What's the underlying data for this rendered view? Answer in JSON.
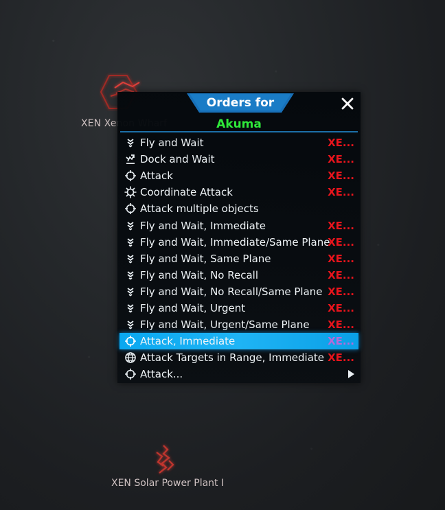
{
  "map": {
    "wharf_label": "XEN Xenon Wharf",
    "solar_label": "XEN Solar Power Plant I"
  },
  "panel": {
    "title": "Orders for",
    "ship_name": "Akuma",
    "close_icon": "close-icon",
    "colors": {
      "accent": "#1c6fa8",
      "ship_name": "#2fe83a",
      "target": "#e8141c",
      "selected_bg": "#0aa8f0"
    },
    "items": [
      {
        "label": "Fly and Wait",
        "target": "XE...",
        "icon": "fly-wait-icon"
      },
      {
        "label": "Dock and Wait",
        "target": "XE...",
        "icon": "dock-wait-icon"
      },
      {
        "label": "Attack",
        "target": "XE...",
        "icon": "crosshair-icon"
      },
      {
        "label": "Coordinate Attack",
        "target": "XE...",
        "icon": "coordinate-attack-icon"
      },
      {
        "label": "Attack multiple objects",
        "target": "",
        "icon": "crosshair-icon"
      },
      {
        "label": "Fly and Wait, Immediate",
        "target": "XE...",
        "icon": "fly-wait-icon"
      },
      {
        "label": "Fly and Wait, Immediate/Same Plane",
        "target": "XE...",
        "icon": "fly-wait-icon"
      },
      {
        "label": "Fly and Wait, Same Plane",
        "target": "XE...",
        "icon": "fly-wait-icon"
      },
      {
        "label": "Fly and Wait, No Recall",
        "target": "XE...",
        "icon": "fly-wait-icon"
      },
      {
        "label": "Fly and Wait, No Recall/Same Plane",
        "target": "XE...",
        "icon": "fly-wait-icon"
      },
      {
        "label": "Fly and Wait, Urgent",
        "target": "XE...",
        "icon": "fly-wait-icon"
      },
      {
        "label": "Fly and Wait, Urgent/Same Plane",
        "target": "XE...",
        "icon": "fly-wait-icon"
      },
      {
        "label": "Attack, Immediate",
        "target": "XE...",
        "icon": "crosshair-icon",
        "selected": true
      },
      {
        "label": "Attack Targets in Range, Immediate",
        "target": "XE...",
        "icon": "globe-icon"
      },
      {
        "label": "Attack...",
        "target": "",
        "icon": "crosshair-icon",
        "submenu": true
      }
    ]
  }
}
